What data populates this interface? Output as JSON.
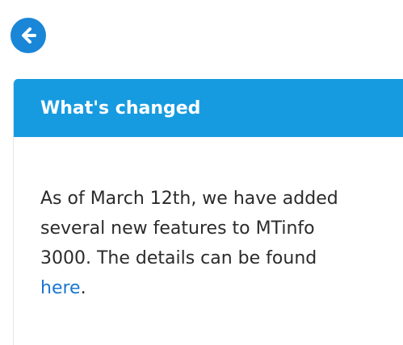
{
  "nav": {
    "back_icon": "arrow-left-circle-icon",
    "accent_color": "#1a86d8"
  },
  "card": {
    "title": "What's changed",
    "header_color": "#179be0",
    "body_prefix": "As of March 12th, we have added several new features to MTinfo 3000. The details can be found ",
    "link_text": "here",
    "link_color": "#1976d2",
    "body_suffix": "."
  }
}
